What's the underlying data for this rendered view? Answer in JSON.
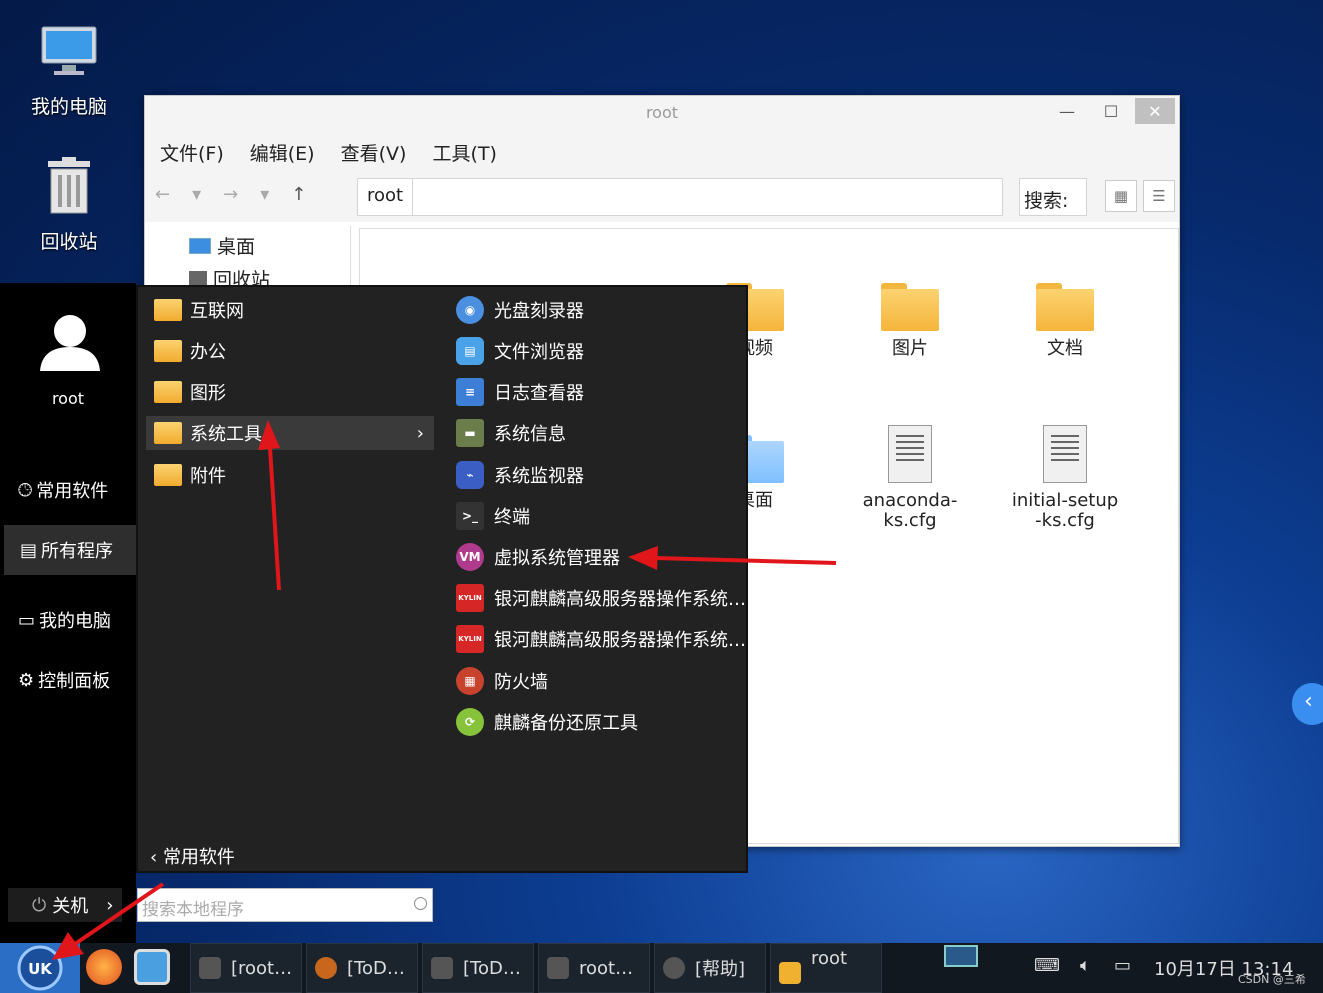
{
  "desktop": {
    "icons": [
      {
        "label": "我的电脑",
        "icon": "computer-icon"
      },
      {
        "label": "回收站",
        "icon": "trash-icon"
      }
    ]
  },
  "file_manager": {
    "title": "root",
    "menus": [
      "文件(F)",
      "编辑(E)",
      "查看(V)",
      "工具(T)"
    ],
    "address_crumb": "root",
    "search_label": "搜索:",
    "side_items": [
      "桌面",
      "回收站"
    ],
    "items": [
      {
        "label": "视频",
        "type": "folder"
      },
      {
        "label": "图片",
        "type": "folder"
      },
      {
        "label": "文档",
        "type": "folder"
      },
      {
        "label": "桌面",
        "type": "folder"
      },
      {
        "label": "anaconda-ks.cfg",
        "type": "file"
      },
      {
        "label": "initial-setup-ks.cfg",
        "type": "file"
      }
    ]
  },
  "start_menu": {
    "user_name": "root",
    "left_nav": [
      "常用软件",
      "所有程序",
      "我的电脑",
      "控制面板"
    ],
    "categories": [
      "互联网",
      "办公",
      "图形",
      "系统工具",
      "附件"
    ],
    "apps": [
      {
        "label": "光盘刻录器",
        "color": "#4a8fe0"
      },
      {
        "label": "文件浏览器",
        "color": "#4aa3e8"
      },
      {
        "label": "日志查看器",
        "color": "#3d7fd6"
      },
      {
        "label": "系统信息",
        "color": "#6b7d4a"
      },
      {
        "label": "系统监视器",
        "color": "#3b5ec4"
      },
      {
        "label": "终端",
        "color": "#333333"
      },
      {
        "label": "虚拟系统管理器",
        "color": "#b03a8c",
        "badge": "VM"
      },
      {
        "label": "银河麒麟高级服务器操作系统…",
        "color": "#d62626",
        "badge": "KYLIN"
      },
      {
        "label": "银河麒麟高级服务器操作系统…",
        "color": "#d62626",
        "badge": "KYLIN"
      },
      {
        "label": "防火墙",
        "color": "#c8432e"
      },
      {
        "label": "麒麟备份还原工具",
        "color": "#86c23a"
      }
    ],
    "back_label": "常用软件",
    "shutdown_label": "关机",
    "search_placeholder": "搜索本地程序"
  },
  "taskbar": {
    "buttons": [
      "[root…",
      "[ToD…",
      "[ToD…",
      "root…",
      "[帮助]",
      "root"
    ],
    "clock": "10月17日 13:14",
    "watermark": "CSDN @三希"
  }
}
